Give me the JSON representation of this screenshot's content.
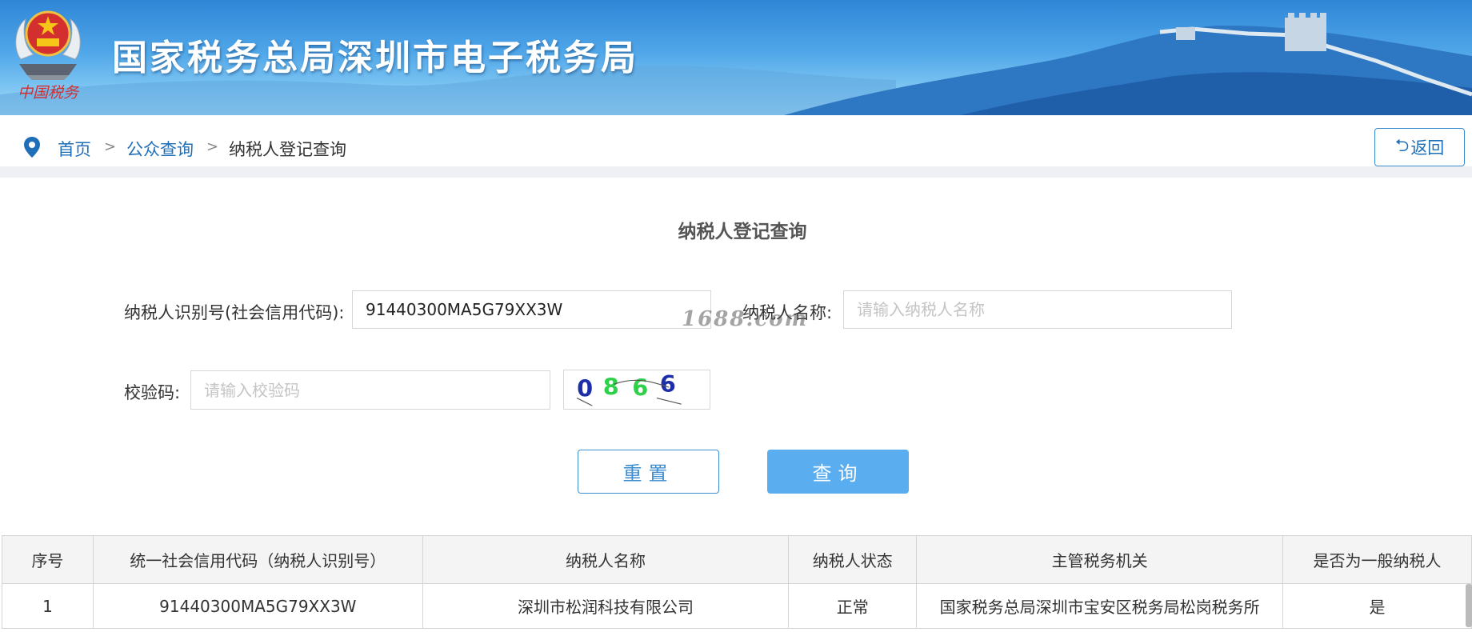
{
  "header": {
    "title": "国家税务总局深圳市电子税务局",
    "emblem_text": "中国税务"
  },
  "breadcrumb": {
    "items": [
      {
        "label": "首页"
      },
      {
        "label": "公众查询"
      },
      {
        "label": "纳税人登记查询"
      }
    ],
    "separator": ">"
  },
  "back_button": {
    "label": "返回",
    "icon": "undo-icon"
  },
  "form": {
    "title": "纳税人登记查询",
    "taxpayer_id": {
      "label": "纳税人识别号(社会信用代码):",
      "value": "91440300MA5G79XX3W"
    },
    "taxpayer_name": {
      "label": "纳税人名称:",
      "placeholder": "请输入纳税人名称",
      "value": ""
    },
    "captcha": {
      "label": "校验码:",
      "placeholder": "请输入校验码",
      "value": "",
      "image_text": "0866"
    },
    "reset_label": "重置",
    "query_label": "查询"
  },
  "watermark": "1688.com",
  "table": {
    "columns": [
      "序号",
      "统一社会信用代码（纳税人识别号）",
      "纳税人名称",
      "纳税人状态",
      "主管税务机关",
      "是否为一般纳税人"
    ],
    "rows": [
      [
        "1",
        "91440300MA5G79XX3W",
        "深圳市松润科技有限公司",
        "正常",
        "国家税务总局深圳市宝安区税务局松岗税务所",
        "是"
      ]
    ]
  },
  "colors": {
    "accent": "#3c8dd0",
    "query_button": "#5aaef0",
    "banner_top": "#2f86d6",
    "link": "#1f6fb8"
  }
}
